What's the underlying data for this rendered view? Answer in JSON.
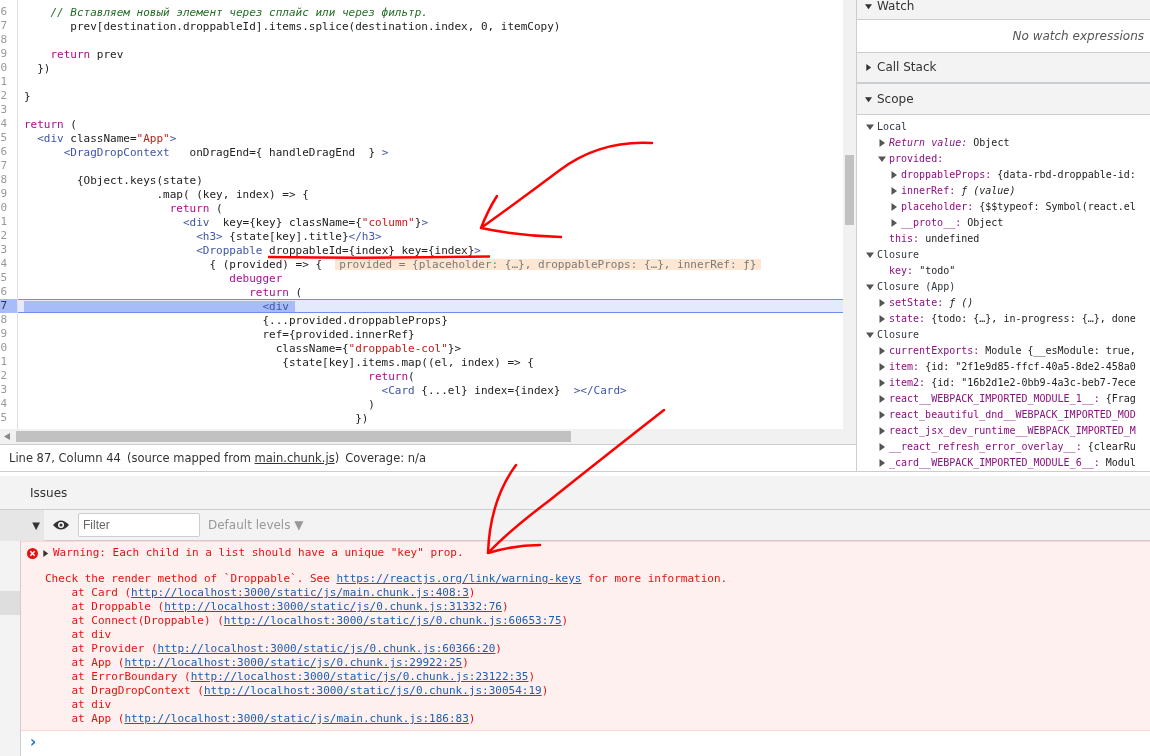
{
  "editor": {
    "lines": [
      {
        "num": "6",
        "current": false,
        "tokens": [
          {
            "kind": "comment",
            "text": "    // Вставляем новый элемент через сплайс или через фильтр."
          }
        ]
      },
      {
        "num": "7",
        "current": false,
        "tokens": [
          {
            "kind": "plain",
            "text": "       prev[destination.droppableId].items.splice(destination.index, 0, itemCopy)"
          }
        ]
      },
      {
        "num": "8",
        "current": false
      },
      {
        "num": "9",
        "current": false,
        "tokens": [
          {
            "kind": "keyword",
            "text": "    return"
          },
          {
            "kind": "plain",
            "text": " prev"
          }
        ]
      },
      {
        "num": "0",
        "current": false,
        "tokens": [
          {
            "kind": "plain",
            "text": "  })"
          }
        ]
      },
      {
        "num": "1",
        "current": false
      },
      {
        "num": "2",
        "current": false,
        "tokens": [
          {
            "kind": "plain",
            "text": "}"
          }
        ]
      },
      {
        "num": "3",
        "current": false
      },
      {
        "num": "4",
        "current": false,
        "tokens": [
          {
            "kind": "keyword",
            "text": "return"
          },
          {
            "kind": "plain",
            "text": " ("
          }
        ]
      },
      {
        "num": "5",
        "current": false,
        "tokens": [
          {
            "kind": "tag",
            "text": "  <div"
          },
          {
            "kind": "plain",
            "text": " className="
          },
          {
            "kind": "string",
            "text": "\"App\""
          },
          {
            "kind": "tag",
            "text": ">"
          }
        ]
      },
      {
        "num": "6",
        "current": false,
        "tokens": [
          {
            "kind": "tag",
            "text": "      <DragDropContext"
          },
          {
            "kind": "plain",
            "text": "   onDragEnd={ handleDragEnd  } "
          },
          {
            "kind": "tag",
            "text": ">"
          }
        ]
      },
      {
        "num": "7",
        "current": false
      },
      {
        "num": "8",
        "current": false,
        "tokens": [
          {
            "kind": "plain",
            "text": "        {Object.keys(state)"
          }
        ]
      },
      {
        "num": "9",
        "current": false,
        "tokens": [
          {
            "kind": "plain",
            "text": "                    .map( (key, index) => {"
          }
        ]
      },
      {
        "num": "0",
        "current": false,
        "tokens": [
          {
            "kind": "keyword",
            "text": "                      return"
          },
          {
            "kind": "plain",
            "text": " ("
          }
        ]
      },
      {
        "num": "1",
        "current": false,
        "tokens": [
          {
            "kind": "tag",
            "text": "                        <div"
          },
          {
            "kind": "plain",
            "text": "  key={key} className={"
          },
          {
            "kind": "string",
            "text": "\"column\""
          },
          {
            "kind": "plain",
            "text": "}"
          },
          {
            "kind": "tag",
            "text": ">"
          }
        ]
      },
      {
        "num": "2",
        "current": false,
        "tokens": [
          {
            "kind": "tag",
            "text": "                          <h3>"
          },
          {
            "kind": "plain",
            "text": " {state[key].title}"
          },
          {
            "kind": "tag",
            "text": "</h3>"
          }
        ]
      },
      {
        "num": "3",
        "current": false,
        "tokens": [
          {
            "kind": "tag",
            "text": "                          <Droppable"
          },
          {
            "kind": "plain",
            "text": " droppableId={index} key={index}"
          },
          {
            "kind": "tag",
            "text": ">"
          }
        ]
      },
      {
        "num": "4",
        "current": false,
        "tokens": [
          {
            "kind": "plain",
            "text": "                            { (provided) => {  "
          },
          {
            "kind": "inline_value",
            "text": "provided = {placeholder: {…}, droppableProps: {…}, innerRef: ƒ}"
          }
        ]
      },
      {
        "num": "5",
        "current": false,
        "tokens": [
          {
            "kind": "keyword",
            "text": "                               debugger"
          }
        ]
      },
      {
        "num": "6",
        "current": false,
        "tokens": [
          {
            "kind": "keyword",
            "text": "                                  return"
          },
          {
            "kind": "plain",
            "text": " ("
          }
        ]
      },
      {
        "num": "7",
        "current": true,
        "tokens": [
          {
            "kind": "tag",
            "text": "                                    <div"
          }
        ]
      },
      {
        "num": "8",
        "current": false,
        "tokens": [
          {
            "kind": "plain",
            "text": "                                    {...provided.droppableProps}"
          }
        ]
      },
      {
        "num": "9",
        "current": false,
        "tokens": [
          {
            "kind": "plain",
            "text": "                                    ref={provided.innerRef}"
          }
        ]
      },
      {
        "num": "0",
        "current": false,
        "tokens": [
          {
            "kind": "plain",
            "text": "                                      className={"
          },
          {
            "kind": "string",
            "text": "\"droppable-col\""
          },
          {
            "kind": "plain",
            "text": "}>"
          }
        ]
      },
      {
        "num": "1",
        "current": false,
        "tokens": [
          {
            "kind": "plain",
            "text": "                                       {state[key].items.map((el, index) => {"
          }
        ]
      },
      {
        "num": "2",
        "current": false,
        "tokens": [
          {
            "kind": "keyword",
            "text": "                                                    return"
          },
          {
            "kind": "plain",
            "text": "("
          }
        ]
      },
      {
        "num": "3",
        "current": false,
        "tokens": [
          {
            "kind": "tag",
            "text": "                                                      <Card"
          },
          {
            "kind": "plain",
            "text": " {...el} index={index}  "
          },
          {
            "kind": "tag",
            "text": "></Card>"
          }
        ]
      },
      {
        "num": "4",
        "current": false,
        "tokens": [
          {
            "kind": "plain",
            "text": "                                                    )"
          }
        ]
      },
      {
        "num": "5",
        "current": false,
        "tokens": [
          {
            "kind": "plain",
            "text": "                                                  })"
          }
        ]
      }
    ]
  },
  "status_bar": {
    "position": "Line 87, Column 44",
    "source_prefix": "(source mapped from ",
    "source_link": "main.chunk.js",
    "source_suffix": ")",
    "coverage": "Coverage: n/a"
  },
  "sidebar": {
    "sections": [
      {
        "title": "Watch",
        "expanded": true,
        "kind": "watch",
        "empty_text": "No watch expressions"
      },
      {
        "title": "Call Stack",
        "expanded": false
      },
      {
        "title": "Scope",
        "expanded": true,
        "kind": "scope",
        "children": [
          {
            "name": "Local",
            "expanded": true,
            "children": [
              {
                "name": "Return value:",
                "value": "Object",
                "italic": true,
                "expandable": true,
                "expanded": false
              },
              {
                "name": "provided:",
                "italic": false,
                "expandable": true,
                "expanded": true,
                "children": [
                  {
                    "name": "droppableProps:",
                    "value": "{data-rbd-droppable-id:",
                    "italic": false,
                    "expandable": true,
                    "expanded": false
                  },
                  {
                    "name": "innerRef:",
                    "value": "ƒ (value)",
                    "kind": "function",
                    "italic": false,
                    "expandable": true,
                    "expanded": false
                  },
                  {
                    "name": "placeholder:",
                    "value": "{$$typeof: Symbol(react.el",
                    "italic": false,
                    "expandable": true,
                    "expanded": false
                  },
                  {
                    "name": "__proto__:",
                    "value": "Object",
                    "italic": false,
                    "expandable": true,
                    "expanded": false
                  }
                ]
              },
              {
                "name": "this:",
                "value": "undefined",
                "italic": false,
                "expandable": false,
                "expanded": false
              }
            ]
          },
          {
            "name": "Closure",
            "expanded": true,
            "children": [
              {
                "name": "key:",
                "value": "\"todo\"",
                "italic": false,
                "expandable": false,
                "expanded": false
              }
            ]
          },
          {
            "name": "Closure (App)",
            "expanded": true,
            "children": [
              {
                "name": "setState:",
                "value": "ƒ ()",
                "kind": "function",
                "italic": false,
                "expandable": true,
                "expanded": false
              },
              {
                "name": "state:",
                "value": "{todo: {…}, in-progress: {…}, done",
                "italic": false,
                "expandable": true,
                "expanded": false
              }
            ]
          },
          {
            "name": "Closure",
            "expanded": true,
            "children": [
              {
                "name": "currentExports:",
                "value": "Module {__esModule: true,",
                "italic": false,
                "expandable": true,
                "expanded": false
              },
              {
                "name": "item:",
                "value": "{id: \"2f1e9d85-ffcf-40a5-8de2-458a0",
                "italic": false,
                "expandable": true,
                "expanded": false
              },
              {
                "name": "item2:",
                "value": "{id: \"16b2d1e2-0bb9-4a3c-beb7-7ece",
                "italic": false,
                "expandable": true,
                "expanded": false
              },
              {
                "name": "react__WEBPACK_IMPORTED_MODULE_1__:",
                "value": "{Frag",
                "italic": false,
                "expandable": true,
                "expanded": false
              },
              {
                "name": "react_beautiful_dnd__WEBPACK_IMPORTED_MOD",
                "italic": false,
                "expandable": true,
                "expanded": false
              },
              {
                "name": "react_jsx_dev_runtime__WEBPACK_IMPORTED_M",
                "italic": false,
                "expandable": true,
                "expanded": false
              },
              {
                "name": "__react_refresh_error_overlay__:",
                "value": "{clearRu",
                "italic": false,
                "expandable": true,
                "expanded": false
              },
              {
                "name": "_card__WEBPACK_IMPORTED_MODULE_6__:",
                "value": "Modul",
                "italic": false,
                "expandable": true,
                "expanded": false
              }
            ]
          }
        ]
      }
    ]
  },
  "console": {
    "tabs": [
      {
        "label": "Issues",
        "selected": false
      }
    ],
    "toolbar": {
      "filter_placeholder": "Filter",
      "levels": "Default levels",
      "levels_caret": "▼",
      "context_caret": "▼"
    },
    "messages": [
      {
        "kind": "error",
        "expanded": false,
        "title": "Warning: Each child in a list should have a unique \"key\" prop.",
        "detail": {
          "before": "Check the render method of `Droppable`. See ",
          "link": "https://reactjs.org/link/warning-keys",
          "after": " for more information."
        },
        "stack": [
          {
            "prefix": "    at Card (",
            "link": "http://localhost:3000/static/js/main.chunk.js:408:3",
            "suffix": ")"
          },
          {
            "prefix": "    at Droppable (",
            "link": "http://localhost:3000/static/js/0.chunk.js:31332:76",
            "suffix": ")"
          },
          {
            "prefix": "    at Connect(Droppable) (",
            "link": "http://localhost:3000/static/js/0.chunk.js:60653:75",
            "suffix": ")"
          },
          {
            "prefix": "    at div"
          },
          {
            "prefix": "    at Provider (",
            "link": "http://localhost:3000/static/js/0.chunk.js:60366:20",
            "suffix": ")"
          },
          {
            "prefix": "    at App (",
            "link": "http://localhost:3000/static/js/0.chunk.js:29922:25",
            "suffix": ")"
          },
          {
            "prefix": "    at ErrorBoundary (",
            "link": "http://localhost:3000/static/js/0.chunk.js:23122:35",
            "suffix": ")"
          },
          {
            "prefix": "    at DragDropContext (",
            "link": "http://localhost:3000/static/js/0.chunk.js:30054:19",
            "suffix": ")"
          },
          {
            "prefix": "    at div"
          },
          {
            "prefix": "    at App (",
            "link": "http://localhost:3000/static/js/main.chunk.js:186:83",
            "suffix": ")"
          }
        ]
      }
    ],
    "prompt": "›"
  },
  "annotations": [
    {
      "kind": "arrow"
    },
    {
      "kind": "underline"
    },
    {
      "kind": "arrow"
    }
  ]
}
